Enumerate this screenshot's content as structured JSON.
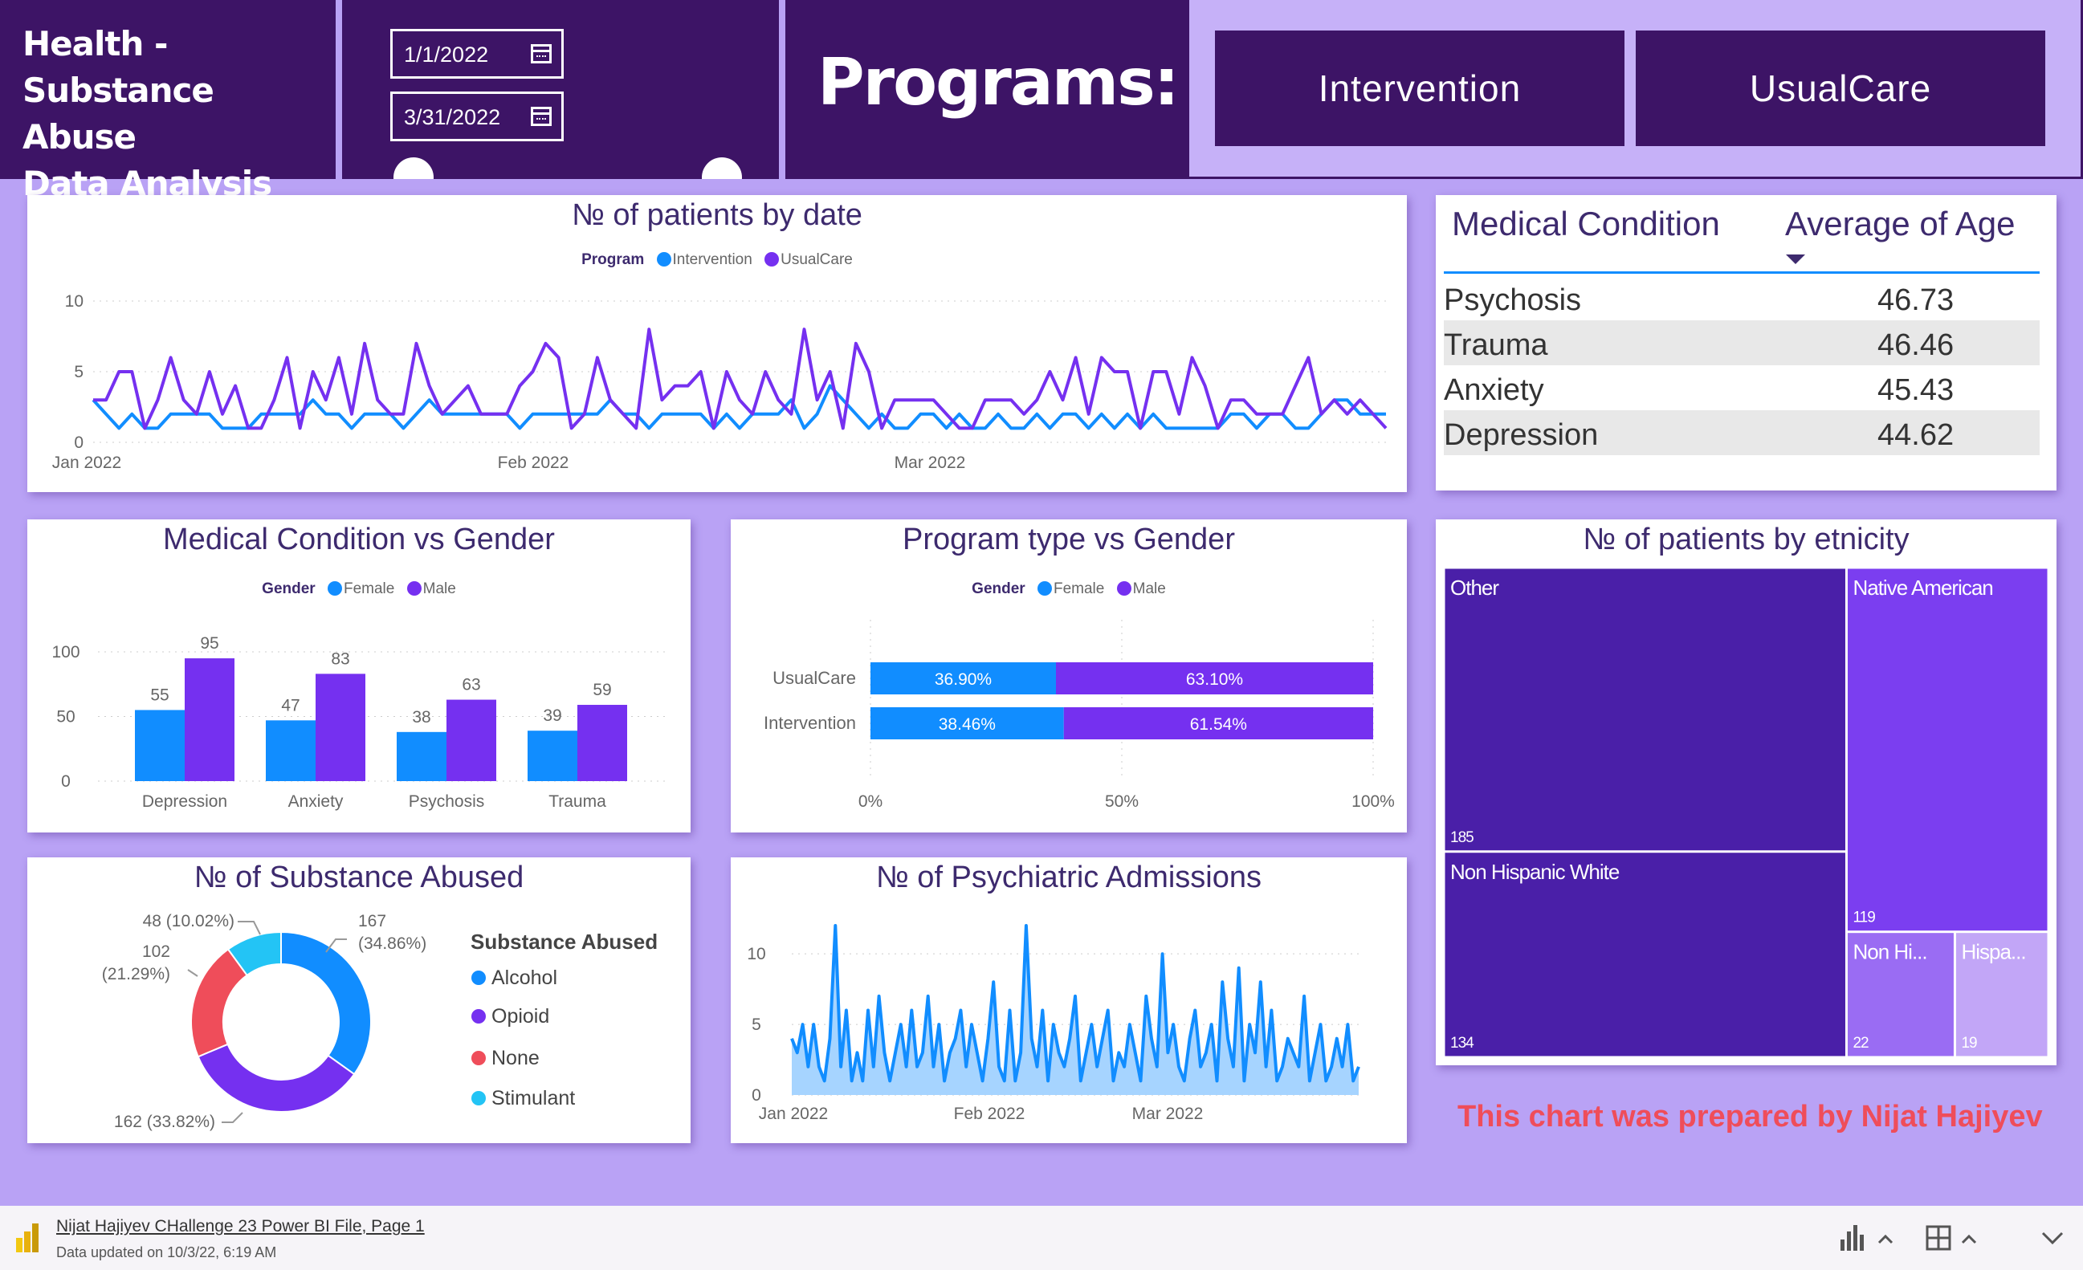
{
  "header": {
    "title_lines": [
      "Health -",
      "Substance Abuse",
      "Data Analysis"
    ],
    "date_start": "1/1/2022",
    "date_end": "3/31/2022",
    "programs_label": "Programs:",
    "buttons": [
      "Intervention",
      "UsualCare"
    ]
  },
  "colors": {
    "header_bg": "#3d1466",
    "page_bg": "#b9a2f5",
    "intervention": "#118dff",
    "usualcare": "#7530f0",
    "female": "#118dff",
    "male": "#7530f0",
    "alcohol": "#118dff",
    "opioid": "#7530f0",
    "none": "#ef4d5a",
    "stimulant": "#23c4f5",
    "credit": "#ef4d5a"
  },
  "patients_by_date": {
    "title": "№ of patients by date",
    "legend_title": "Program",
    "legend": [
      "Intervention",
      "UsualCare"
    ],
    "x_ticks": [
      "Jan 2022",
      "Feb 2022",
      "Mar 2022"
    ],
    "y_ticks": [
      "0",
      "5",
      "10"
    ],
    "chart_data": {
      "type": "line",
      "x_start": "2022-01-01",
      "ylim": [
        0,
        10
      ],
      "series": [
        {
          "name": "Intervention",
          "values": [
            3,
            2,
            1,
            2,
            1,
            1,
            2,
            2,
            2,
            2,
            1,
            1,
            1,
            2,
            2,
            2,
            2,
            3,
            2,
            2,
            1,
            2,
            2,
            2,
            1,
            2,
            3,
            2,
            2,
            2,
            2,
            2,
            2,
            1,
            2,
            2,
            2,
            2,
            2,
            2,
            3,
            2,
            2,
            1,
            2,
            2,
            2,
            2,
            1,
            2,
            1,
            2,
            2,
            2,
            3,
            1,
            2,
            4,
            3,
            2,
            1,
            2,
            1,
            1,
            2,
            2,
            1,
            2,
            1,
            1,
            2,
            1,
            1,
            2,
            1,
            2,
            2,
            1,
            2,
            1,
            2,
            1,
            2,
            1,
            1,
            1,
            1,
            1,
            2,
            2,
            1,
            2,
            2,
            1,
            1,
            2,
            3,
            3,
            2,
            2,
            2
          ]
        },
        {
          "name": "UsualCare",
          "values": [
            3,
            3,
            5,
            5,
            1,
            3,
            6,
            3,
            2,
            5,
            2,
            4,
            1,
            1,
            3,
            6,
            1,
            5,
            3,
            6,
            2,
            7,
            3,
            2,
            2,
            7,
            4,
            2,
            3,
            4,
            2,
            2,
            2,
            4,
            5,
            7,
            6,
            1,
            2,
            6,
            3,
            2,
            1,
            8,
            3,
            4,
            4,
            5,
            1,
            5,
            3,
            2,
            5,
            3,
            2,
            8,
            3,
            5,
            1,
            7,
            5,
            1,
            3,
            3,
            3,
            3,
            2,
            1,
            1,
            3,
            3,
            3,
            2,
            3,
            5,
            3,
            6,
            2,
            6,
            5,
            5,
            1,
            5,
            5,
            2,
            6,
            4,
            1,
            3,
            3,
            2,
            2,
            2,
            4,
            6,
            2,
            3,
            2,
            3,
            2,
            1
          ]
        }
      ]
    }
  },
  "age_table": {
    "headers": [
      "Medical Condition",
      "Average of Age"
    ],
    "rows": [
      {
        "condition": "Psychosis",
        "avg_age": "46.73"
      },
      {
        "condition": "Trauma",
        "avg_age": "46.46"
      },
      {
        "condition": "Anxiety",
        "avg_age": "45.43"
      },
      {
        "condition": "Depression",
        "avg_age": "44.62"
      }
    ]
  },
  "condition_gender": {
    "title": "Medical Condition vs Gender",
    "legend_title": "Gender",
    "legend": [
      "Female",
      "Male"
    ],
    "y_ticks": [
      "0",
      "50",
      "100"
    ],
    "chart_data": {
      "type": "bar",
      "categories": [
        "Depression",
        "Anxiety",
        "Psychosis",
        "Trauma"
      ],
      "series": [
        {
          "name": "Female",
          "values": [
            55,
            47,
            38,
            39
          ]
        },
        {
          "name": "Male",
          "values": [
            95,
            83,
            63,
            59
          ]
        }
      ],
      "ylim": [
        0,
        100
      ]
    }
  },
  "program_gender": {
    "title": "Program type vs Gender",
    "legend_title": "Gender",
    "legend": [
      "Female",
      "Male"
    ],
    "x_ticks": [
      "0%",
      "50%",
      "100%"
    ],
    "chart_data": {
      "type": "bar",
      "orientation": "horizontal",
      "stacked": "100%",
      "categories": [
        "UsualCare",
        "Intervention"
      ],
      "series": [
        {
          "name": "Female",
          "values": [
            36.9,
            38.46
          ],
          "labels": [
            "36.90%",
            "38.46%"
          ]
        },
        {
          "name": "Male",
          "values": [
            63.1,
            61.54
          ],
          "labels": [
            "63.10%",
            "61.54%"
          ]
        }
      ]
    }
  },
  "ethnicity": {
    "title": "№ of patients by etnicity",
    "chart_data": {
      "type": "treemap",
      "items": [
        {
          "name": "Other",
          "label": "Other",
          "value": 185
        },
        {
          "name": "Non Hispanic White",
          "label": "Non Hispanic White",
          "value": 134
        },
        {
          "name": "Native American",
          "label": "Native American",
          "value": 119
        },
        {
          "name": "Non Hispanic",
          "label": "Non Hi...",
          "value": 22
        },
        {
          "name": "Hispanic",
          "label": "Hispa...",
          "value": 19
        }
      ]
    }
  },
  "substance": {
    "title": "№ of Substance Abused",
    "legend_title": "Substance Abused",
    "chart_data": {
      "type": "pie",
      "donut": true,
      "slices": [
        {
          "name": "Alcohol",
          "value": 167,
          "label": [
            "167",
            "(34.86%)"
          ]
        },
        {
          "name": "Opioid",
          "value": 162,
          "label": [
            "162 (33.82%)"
          ]
        },
        {
          "name": "None",
          "value": 102,
          "label": [
            "102",
            "(21.29%)"
          ]
        },
        {
          "name": "Stimulant",
          "value": 48,
          "label": [
            "48 (10.02%)"
          ]
        }
      ]
    }
  },
  "admissions": {
    "title": "№ of Psychiatric Admissions",
    "x_ticks": [
      "Jan 2022",
      "Feb 2022",
      "Mar 2022"
    ],
    "y_ticks": [
      "0",
      "5",
      "10"
    ],
    "chart_data": {
      "type": "area",
      "x_start": "2022-01-01",
      "ylim": [
        0,
        12
      ],
      "values": [
        4,
        3,
        5,
        2,
        5,
        2,
        1,
        4,
        12,
        2,
        6,
        1,
        3,
        1,
        6,
        2,
        7,
        3,
        1,
        3,
        5,
        2,
        6,
        2,
        3,
        7,
        2,
        5,
        1,
        3,
        4,
        6,
        2,
        5,
        3,
        1,
        4,
        8,
        2,
        1,
        6,
        1,
        3,
        12,
        4,
        2,
        6,
        1,
        5,
        3,
        2,
        4,
        7,
        1,
        3,
        5,
        2,
        4,
        6,
        1,
        3,
        2,
        5,
        3,
        1,
        7,
        4,
        2,
        10,
        3,
        5,
        2,
        1,
        4,
        6,
        2,
        3,
        5,
        1,
        8,
        4,
        2,
        9,
        1,
        5,
        3,
        8,
        2,
        6,
        1,
        2,
        4,
        3,
        2,
        7,
        1,
        3,
        5,
        1,
        2,
        4,
        2,
        5,
        1,
        2
      ]
    }
  },
  "credit": "This chart was prepared by Nijat Hajiyev",
  "footer": {
    "file": "Nijat Hajiyev CHallenge 23 Power BI File, Page 1",
    "updated": "Data updated on 10/3/22, 6:19 AM"
  }
}
